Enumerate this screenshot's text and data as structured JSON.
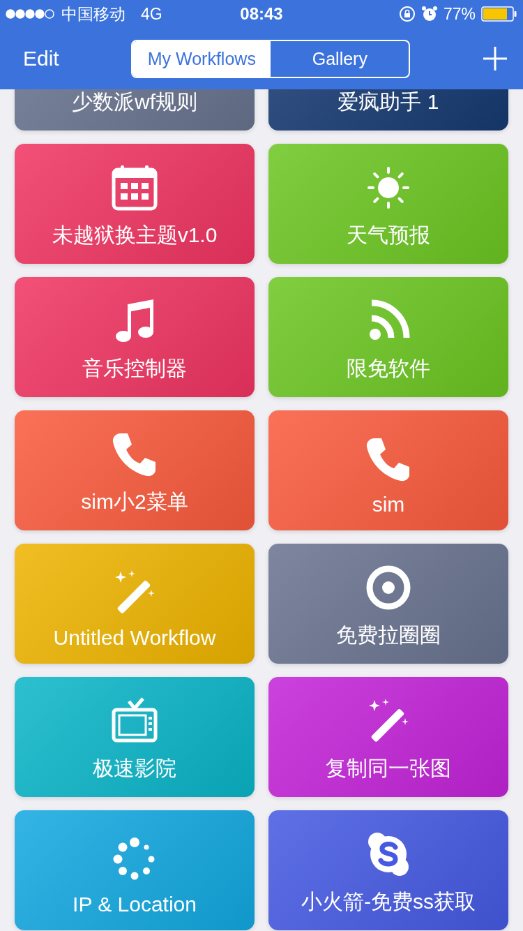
{
  "status_bar": {
    "carrier": "中国移动",
    "network": "4G",
    "time": "08:43",
    "battery": "77%"
  },
  "nav": {
    "edit": "Edit",
    "tabs": [
      {
        "label": "My Workflows",
        "selected": true
      },
      {
        "label": "Gallery",
        "selected": false
      }
    ]
  },
  "workflows": [
    {
      "title": "少数派wf规则",
      "kind": "none",
      "color": "#68738f"
    },
    {
      "title": "爱疯助手 1",
      "kind": "none",
      "color": "#163a72"
    },
    {
      "title": "未越狱换主题v1.0",
      "kind": "calendar",
      "color": "#f03461"
    },
    {
      "title": "天气预报",
      "kind": "sun",
      "color": "#6cc622"
    },
    {
      "title": "音乐控制器",
      "kind": "music",
      "color": "#f03461"
    },
    {
      "title": "限免软件",
      "kind": "rss",
      "color": "#6cc622"
    },
    {
      "title": "sim小2菜单",
      "kind": "phone",
      "color": "#f95a3c"
    },
    {
      "title": "sim",
      "kind": "phone",
      "color": "#f95a3c"
    },
    {
      "title": "Untitled Workflow",
      "kind": "wand",
      "color": "#eeb400"
    },
    {
      "title": "免费拉圈圈",
      "kind": "target",
      "color": "#69738f"
    },
    {
      "title": "极速影院",
      "kind": "tv",
      "color": "#0ab5c8"
    },
    {
      "title": "复制同一张图",
      "kind": "wand",
      "color": "#c323d8"
    },
    {
      "title": "IP & Location",
      "kind": "spinner",
      "color": "#12a8e0"
    },
    {
      "title": "小火箭-免费ss获取",
      "kind": "skype",
      "color": "#4559e2"
    }
  ]
}
